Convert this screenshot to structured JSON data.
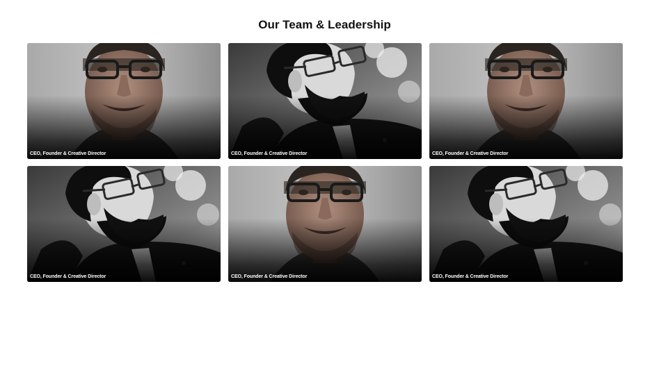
{
  "page": {
    "title": "Our Team & Leadership"
  },
  "team": {
    "members": [
      {
        "role": "CEO, Founder & Creative Director",
        "photo": "smiling-man-glasses"
      },
      {
        "role": "CEO, Founder & Creative Director",
        "photo": "bearded-man-profile"
      },
      {
        "role": "CEO, Founder & Creative Director",
        "photo": "smiling-man-glasses"
      },
      {
        "role": "CEO, Founder & Creative Director",
        "photo": "bearded-man-profile"
      },
      {
        "role": "CEO, Founder & Creative Director",
        "photo": "smiling-man-glasses"
      },
      {
        "role": "CEO, Founder & Creative Director",
        "photo": "bearded-man-profile"
      }
    ]
  },
  "colors": {
    "background": "#ffffff",
    "title": "#111111",
    "caption": "#ffffff"
  }
}
